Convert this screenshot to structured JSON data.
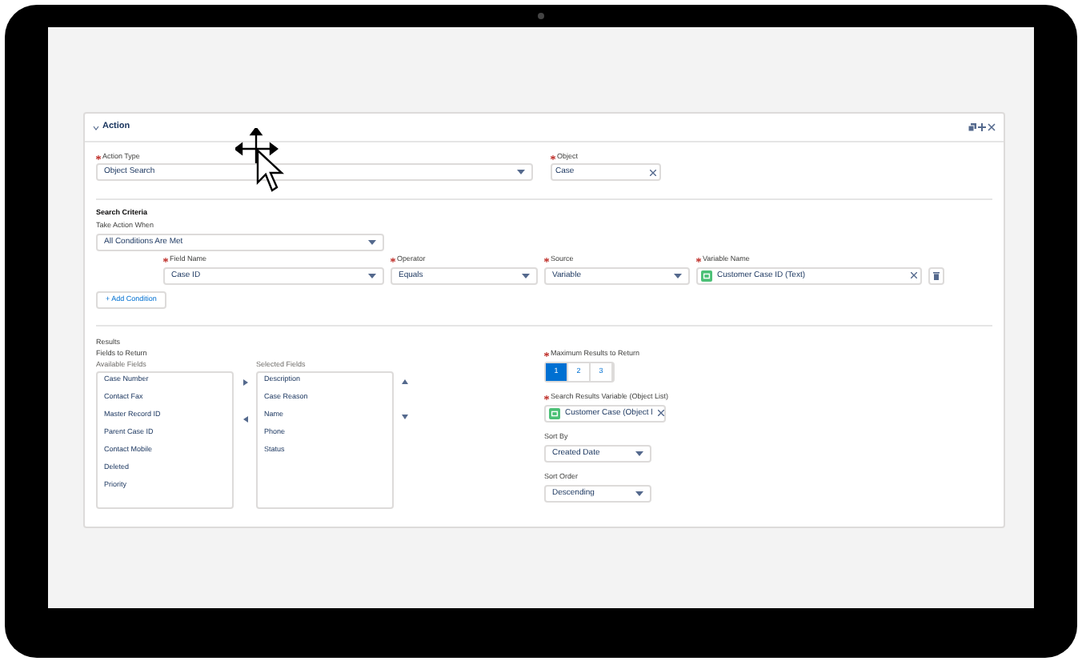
{
  "panel": {
    "title": "Action",
    "expanded": true
  },
  "action_type": {
    "label": "Action Type",
    "required": true,
    "value": "Object Search"
  },
  "object": {
    "label": "Object",
    "required": true,
    "value": "Case"
  },
  "search_criteria": {
    "heading": "Search Criteria",
    "take_action_when": {
      "label": "Take Action When",
      "required": false,
      "value": "All Conditions Are Met"
    },
    "conditions": [
      {
        "field_name": {
          "label": "Field Name",
          "required": true,
          "value": "Case ID"
        },
        "operator": {
          "label": "Operator",
          "required": true,
          "value": "Equals"
        },
        "source": {
          "label": "Source",
          "required": true,
          "value": "Variable"
        },
        "variable_name": {
          "label": "Variable Name",
          "required": true,
          "value": "Customer Case ID (Text)"
        }
      }
    ],
    "add_button": "+ Add Condition"
  },
  "results": {
    "heading": "Results",
    "subheading": "Fields to Return",
    "available_fields": {
      "label": "Available Fields",
      "items": [
        "Case Number",
        "Contact Fax",
        "Master Record ID",
        "Parent Case ID",
        "Contact Mobile",
        "Deleted",
        "Priority"
      ]
    },
    "selected_fields": {
      "label": "Selected Fields",
      "items": [
        "Description",
        "Case Reason",
        "Name",
        "Phone",
        "Status"
      ]
    },
    "max_results": {
      "label": "Maximum Results to Return",
      "required": true,
      "options": [
        {
          "label": "1",
          "selected": true
        },
        {
          "label": "2",
          "selected": false
        },
        {
          "label": "3",
          "selected": false
        }
      ]
    },
    "results_variable": {
      "label": "Search Results Variable (Object List)",
      "required": true,
      "value": "Customer Case (Object l"
    },
    "sort_by": {
      "label": "Sort By",
      "required": false,
      "value": "Created Date"
    },
    "sort_order": {
      "label": "Sort Order",
      "required": false,
      "value": "Descending"
    }
  }
}
